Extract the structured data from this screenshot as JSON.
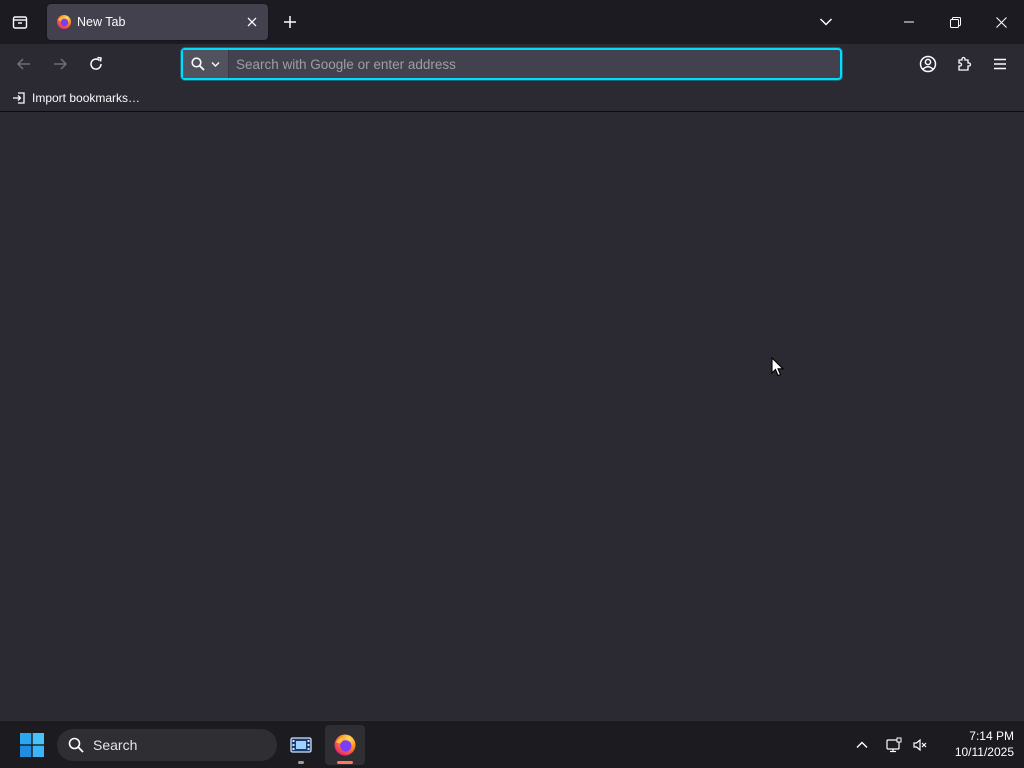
{
  "browser": {
    "tabs": [
      {
        "title": "New Tab",
        "favicon": "firefox-icon",
        "active": true
      }
    ],
    "urlbar": {
      "placeholder": "Search with Google or enter address",
      "value": ""
    },
    "bookmarks": [
      {
        "label": "Import bookmarks…",
        "icon": "import-icon"
      }
    ],
    "colors": {
      "accent": "#00ddff",
      "toolbar": "#2b2a33",
      "titlebar": "#1c1b22",
      "tab": "#42414d"
    }
  },
  "taskbar": {
    "search_label": "Search",
    "apps": [
      {
        "name": "film-app",
        "icon": "film-strip-icon"
      },
      {
        "name": "firefox",
        "icon": "firefox-icon",
        "active": true
      }
    ],
    "clock": {
      "time": "7:14 PM",
      "date": "10/11/2025"
    }
  }
}
